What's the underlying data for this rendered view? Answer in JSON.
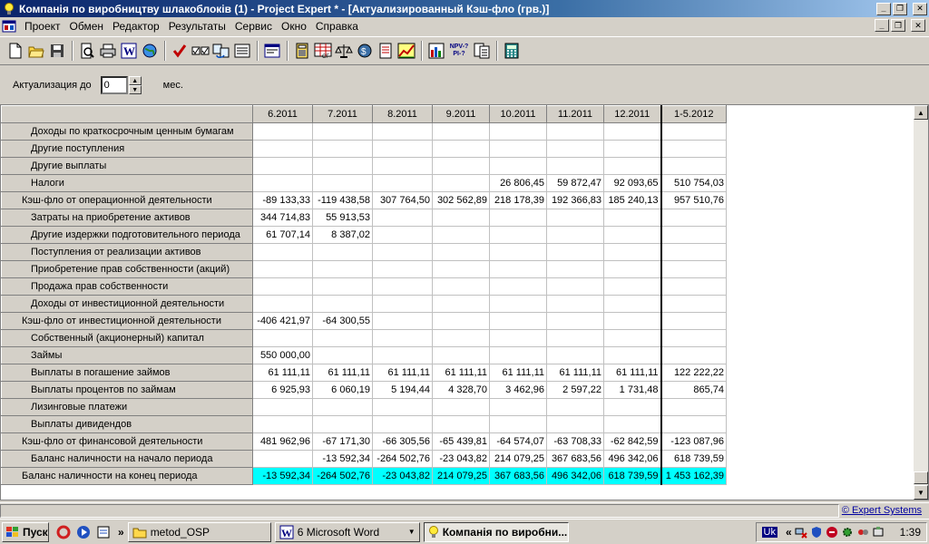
{
  "window": {
    "title": "Компанія по виробництву шлакоблоків (1) - Project Expert * - [Актуализированный Кэш-фло (грв.)]",
    "minimize": "_",
    "restore": "❐",
    "close": "✕"
  },
  "menu": {
    "items": [
      "Проект",
      "Обмен",
      "Редактор",
      "Результаты",
      "Сервис",
      "Окно",
      "Справка"
    ]
  },
  "toolbar": {
    "icons": [
      "new-icon",
      "open-icon",
      "save-icon",
      "preview-icon",
      "print-icon",
      "word-icon",
      "web-icon",
      "check-icon",
      "check-list-icon",
      "convert-icon",
      "list-icon",
      "table-icon",
      "calc-icon",
      "cashflow-icon",
      "scales-icon",
      "bank-icon",
      "report-icon",
      "chart-icon",
      "grid-icon",
      "npv-icon",
      "doc-icon",
      "calculator-icon"
    ],
    "npv_label_top": "NPV-?",
    "npv_label_bottom": "PI-?"
  },
  "actualization": {
    "label": "Актуализация до",
    "value": "0",
    "unit": "мес."
  },
  "grid": {
    "columns": [
      "6.2011",
      "7.2011",
      "8.2011",
      "9.2011",
      "10.2011",
      "11.2011",
      "12.2011",
      "1-5.2012"
    ],
    "rows": [
      {
        "label": "Доходы по краткосрочным ценным бумагам",
        "indent": 1,
        "values": [
          "",
          "",
          "",
          "",
          "",
          "",
          "",
          ""
        ]
      },
      {
        "label": "Другие поступления",
        "indent": 1,
        "values": [
          "",
          "",
          "",
          "",
          "",
          "",
          "",
          ""
        ]
      },
      {
        "label": "Другие выплаты",
        "indent": 1,
        "values": [
          "",
          "",
          "",
          "",
          "",
          "",
          "",
          ""
        ]
      },
      {
        "label": "Налоги",
        "indent": 1,
        "values": [
          "",
          "",
          "",
          "",
          "26 806,45",
          "59 872,47",
          "92 093,65",
          "510 754,03"
        ]
      },
      {
        "label": "Кэш-фло от операционной деятельности",
        "indent": 0,
        "values": [
          "-89 133,33",
          "-119 438,58",
          "307 764,50",
          "302 562,89",
          "218 178,39",
          "192 366,83",
          "185 240,13",
          "957 510,76"
        ]
      },
      {
        "label": "Затраты на приобретение активов",
        "indent": 1,
        "values": [
          "344 714,83",
          "55 913,53",
          "",
          "",
          "",
          "",
          "",
          ""
        ]
      },
      {
        "label": "Другие издержки подготовительного периода",
        "indent": 1,
        "values": [
          "61 707,14",
          "8 387,02",
          "",
          "",
          "",
          "",
          "",
          ""
        ]
      },
      {
        "label": "Поступления от реализации активов",
        "indent": 1,
        "values": [
          "",
          "",
          "",
          "",
          "",
          "",
          "",
          ""
        ]
      },
      {
        "label": "Приобретение прав собственности (акций)",
        "indent": 1,
        "values": [
          "",
          "",
          "",
          "",
          "",
          "",
          "",
          ""
        ]
      },
      {
        "label": "Продажа прав собственности",
        "indent": 1,
        "values": [
          "",
          "",
          "",
          "",
          "",
          "",
          "",
          ""
        ]
      },
      {
        "label": "Доходы от инвестиционной деятельности",
        "indent": 1,
        "values": [
          "",
          "",
          "",
          "",
          "",
          "",
          "",
          ""
        ]
      },
      {
        "label": "Кэш-фло от инвестиционной деятельности",
        "indent": 0,
        "values": [
          "-406 421,97",
          "-64 300,55",
          "",
          "",
          "",
          "",
          "",
          ""
        ]
      },
      {
        "label": "Собственный (акционерный) капитал",
        "indent": 1,
        "values": [
          "",
          "",
          "",
          "",
          "",
          "",
          "",
          ""
        ]
      },
      {
        "label": "Займы",
        "indent": 1,
        "values": [
          "550 000,00",
          "",
          "",
          "",
          "",
          "",
          "",
          ""
        ]
      },
      {
        "label": "Выплаты в погашение займов",
        "indent": 1,
        "values": [
          "61 111,11",
          "61 111,11",
          "61 111,11",
          "61 111,11",
          "61 111,11",
          "61 111,11",
          "61 111,11",
          "122 222,22"
        ]
      },
      {
        "label": "Выплаты процентов по займам",
        "indent": 1,
        "values": [
          "6 925,93",
          "6 060,19",
          "5 194,44",
          "4 328,70",
          "3 462,96",
          "2 597,22",
          "1 731,48",
          "865,74"
        ]
      },
      {
        "label": "Лизинговые платежи",
        "indent": 1,
        "values": [
          "",
          "",
          "",
          "",
          "",
          "",
          "",
          ""
        ]
      },
      {
        "label": "Выплаты дивидендов",
        "indent": 1,
        "values": [
          "",
          "",
          "",
          "",
          "",
          "",
          "",
          ""
        ]
      },
      {
        "label": "Кэш-фло от финансовой деятельности",
        "indent": 0,
        "values": [
          "481 962,96",
          "-67 171,30",
          "-66 305,56",
          "-65 439,81",
          "-64 574,07",
          "-63 708,33",
          "-62 842,59",
          "-123 087,96"
        ]
      },
      {
        "label": "Баланс наличности на начало периода",
        "indent": 1,
        "values": [
          "",
          "-13 592,34",
          "-264 502,76",
          "-23 043,82",
          "214 079,25",
          "367 683,56",
          "496 342,06",
          "618 739,59"
        ]
      },
      {
        "label": "Баланс наличности на конец периода",
        "indent": 0,
        "highlight": true,
        "values": [
          "-13 592,34",
          "-264 502,76",
          "-23 043,82",
          "214 079,25",
          "367 683,56",
          "496 342,06",
          "618 739,59",
          "1 453 162,39"
        ]
      }
    ],
    "highlight_color": "#00ffff"
  },
  "status": {
    "brand": "© Expert Systems"
  },
  "taskbar": {
    "start": "Пуск",
    "chevron": "»",
    "tasks": [
      {
        "label": "metod_OSP",
        "icon": "folder-icon"
      },
      {
        "label": "6 Microsoft Word",
        "icon": "word-icon"
      },
      {
        "label": "Компанія по виробни...",
        "icon": "bulb-icon",
        "active": true
      }
    ],
    "tray_lang": "Uk",
    "tray_chevron": "«",
    "clock": "1:39"
  }
}
